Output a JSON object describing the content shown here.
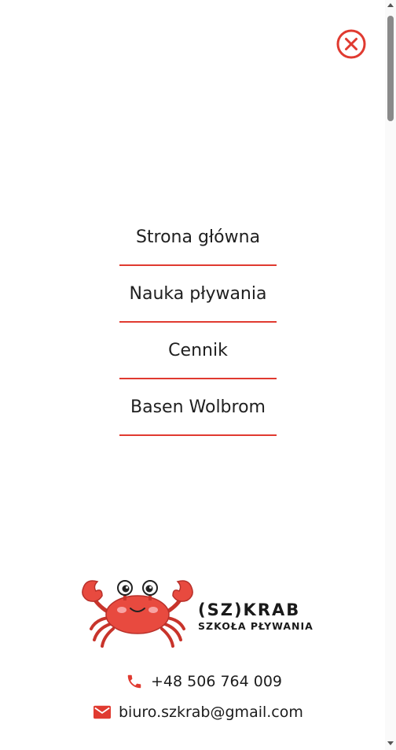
{
  "menu": {
    "items": [
      {
        "label": "Strona główna"
      },
      {
        "label": "Nauka pływania"
      },
      {
        "label": "Cennik"
      },
      {
        "label": "Basen Wolbrom"
      }
    ]
  },
  "brand": {
    "name": "(SZ)KRAB",
    "tagline": "SZKOŁA PŁYWANIA"
  },
  "contact": {
    "phone": "+48 506 764 009",
    "email": "biuro.szkrab@gmail.com"
  },
  "colors": {
    "accent": "#e03a30",
    "crab": "#e84a3f",
    "text": "#1b1b1b"
  },
  "icons": {
    "close": "close-circle-icon",
    "phone": "phone-icon",
    "email": "envelope-icon"
  }
}
